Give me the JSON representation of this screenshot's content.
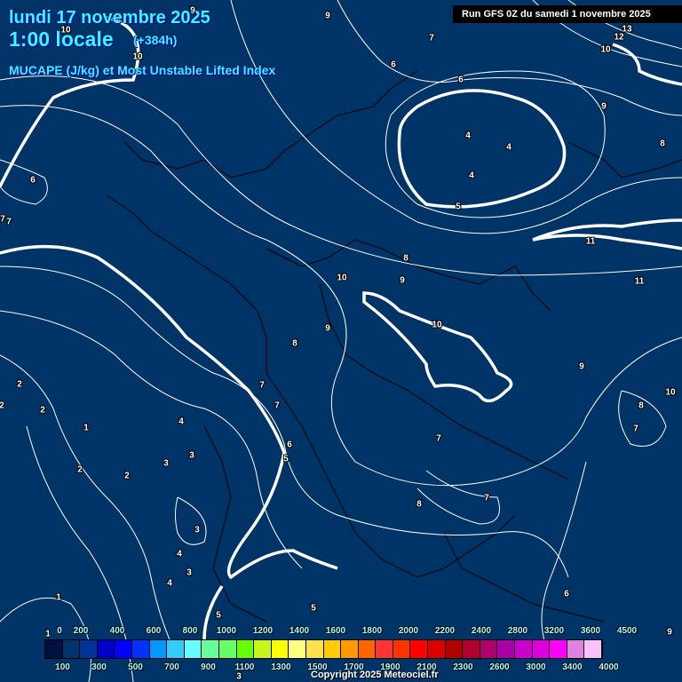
{
  "header": {
    "date": "lundi 17 novembre 2025",
    "time": "1:00 locale",
    "offset": "(+384h)",
    "parameter": "MUCAPE (J/kg) et Most Unstable Lifted Index",
    "run": "Run GFS 0Z du samedi 1 novembre 2025"
  },
  "colors": {
    "background": "#003366",
    "contour": "#ffffff",
    "header_text": "#33ffff"
  },
  "contour_labels": [
    "9",
    "9",
    "10",
    "10",
    "7",
    "13",
    "12",
    "10",
    "6",
    "6",
    "9",
    "8",
    "4",
    "4",
    "4",
    "5",
    "6",
    "7",
    "7",
    "11",
    "8",
    "10",
    "9",
    "11",
    "10",
    "9",
    "8",
    "9",
    "2",
    "2",
    "2",
    "7",
    "7",
    "8",
    "10",
    "7",
    "4",
    "1",
    "7",
    "6",
    "5",
    "3",
    "3",
    "2",
    "2",
    "7",
    "8",
    "3",
    "4",
    "3",
    "4",
    "6",
    "1",
    "5",
    "5",
    "1",
    "9",
    "3"
  ],
  "legend": {
    "labels": [
      "0",
      "100",
      "200",
      "300",
      "400",
      "500",
      "600",
      "700",
      "800",
      "900",
      "1000",
      "1100",
      "1200",
      "1300",
      "1400",
      "1500",
      "1600",
      "1700",
      "1800",
      "1900",
      "2000",
      "2100",
      "2200",
      "2300",
      "2400",
      "2600",
      "2800",
      "3000",
      "3200",
      "3400",
      "3600",
      "4000",
      "4500"
    ],
    "colors": [
      "#001040",
      "#00336a",
      "#003399",
      "#0000cc",
      "#0000ff",
      "#0033ff",
      "#0099ff",
      "#33ccff",
      "#66ffff",
      "#66ff99",
      "#66ff66",
      "#66ff00",
      "#c6f51a",
      "#ffff00",
      "#ffff80",
      "#ffe04d",
      "#ffcc00",
      "#ff9900",
      "#ff6600",
      "#ff3333",
      "#ff3300",
      "#ff0000",
      "#dd0000",
      "#b00000",
      "#b00030",
      "#b00070",
      "#aa00aa",
      "#cc00cc",
      "#dd00dd",
      "#ff00ff",
      "#e080e0",
      "#ffc0ff",
      "#ffffff"
    ]
  },
  "copyright": "Copyright 2025 Meteociel.fr"
}
